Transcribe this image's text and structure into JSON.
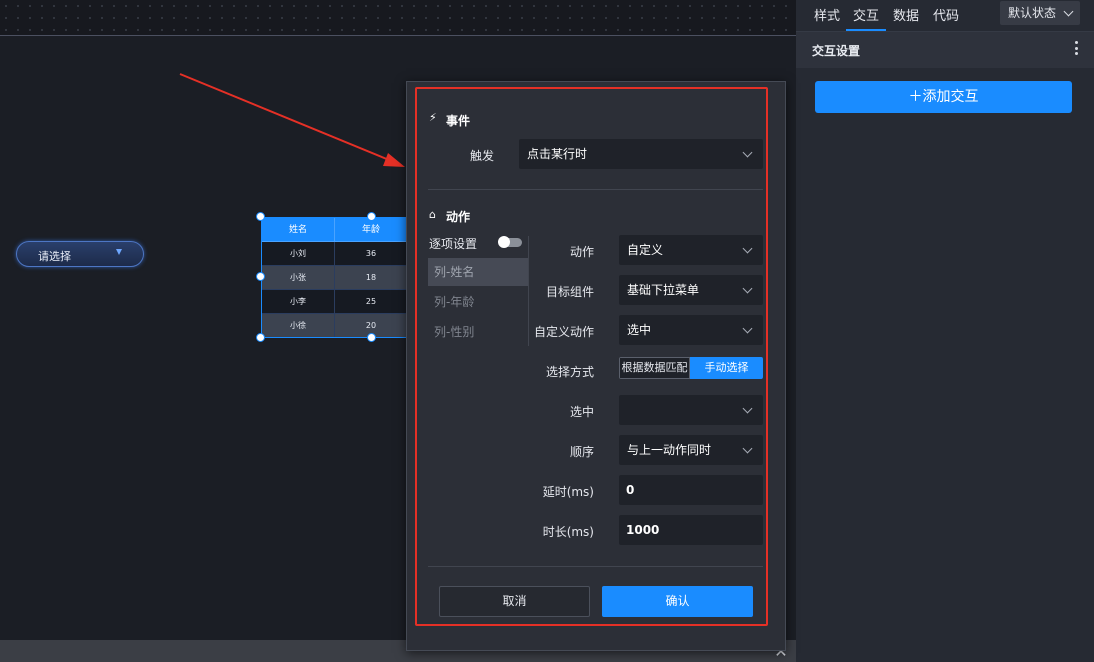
{
  "right_panel": {
    "tabs": [
      "样式",
      "交互",
      "数据",
      "代码"
    ],
    "active_tab": "交互",
    "state_select": "默认状态",
    "section_title": "交互设置",
    "add_button": "添加交互"
  },
  "canvas": {
    "dropdown_widget": {
      "placeholder": "请选择",
      "caret": "▼"
    },
    "table_widget": {
      "columns": [
        "姓名",
        "年龄"
      ],
      "rows": [
        [
          "小刘",
          "36"
        ],
        [
          "小张",
          "18"
        ],
        [
          "小李",
          "25"
        ],
        [
          "小徐",
          "20"
        ]
      ]
    }
  },
  "dialog": {
    "event_section": {
      "icon": "lightning-icon",
      "title": "事件",
      "trigger_label": "触发",
      "trigger_value": "点击某行时"
    },
    "action_section": {
      "icon": "action-icon",
      "title": "动作",
      "per_item_label": "逐项设置",
      "columns": [
        "列-姓名",
        "列-年龄",
        "列-性别"
      ],
      "selected_column": "列-姓名",
      "fields": {
        "action_label": "动作",
        "action_value": "自定义",
        "target_label": "目标组件",
        "target_value": "基础下拉菜单",
        "custom_action_label": "自定义动作",
        "custom_action_value": "选中",
        "select_mode_label": "选择方式",
        "select_mode_options": [
          "根据数据匹配",
          "手动选择"
        ],
        "select_mode_active": "手动选择",
        "selected_label": "选中",
        "selected_value": "",
        "order_label": "顺序",
        "order_value": "与上一动作同时",
        "delay_label": "延时(ms)",
        "delay_value": "0",
        "duration_label": "时长(ms)",
        "duration_value": "1000"
      }
    },
    "cancel_button": "取消",
    "confirm_button": "确认"
  },
  "close_icon_glyph": "✕",
  "colors": {
    "accent": "#1a8cff",
    "annotation_red": "#e53026",
    "panel_bg": "#262a33",
    "dialog_bg": "#2c2f37"
  }
}
